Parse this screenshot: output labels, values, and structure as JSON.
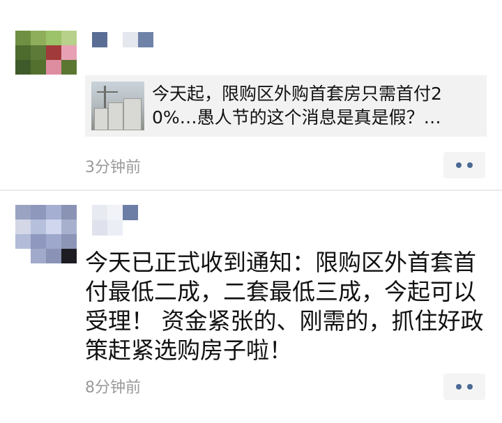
{
  "posts": [
    {
      "share": {
        "title": "今天起，限购区外购首套房只需首付20%…愚人节的这个消息是真是假？…"
      },
      "time": "3分钟前"
    },
    {
      "text": "今天已正式收到通知：限购区外首套首付最低二成，二套最低三成，今起可以受理！ 资金紧张的、刚需的，抓住好政策赶紧选购房子啦！",
      "time": "8分钟前"
    }
  ],
  "icons": {
    "more": "more-dots-icon",
    "avatar": "pixelated-avatar",
    "thumbnail": "building-construction-thumbnail"
  }
}
